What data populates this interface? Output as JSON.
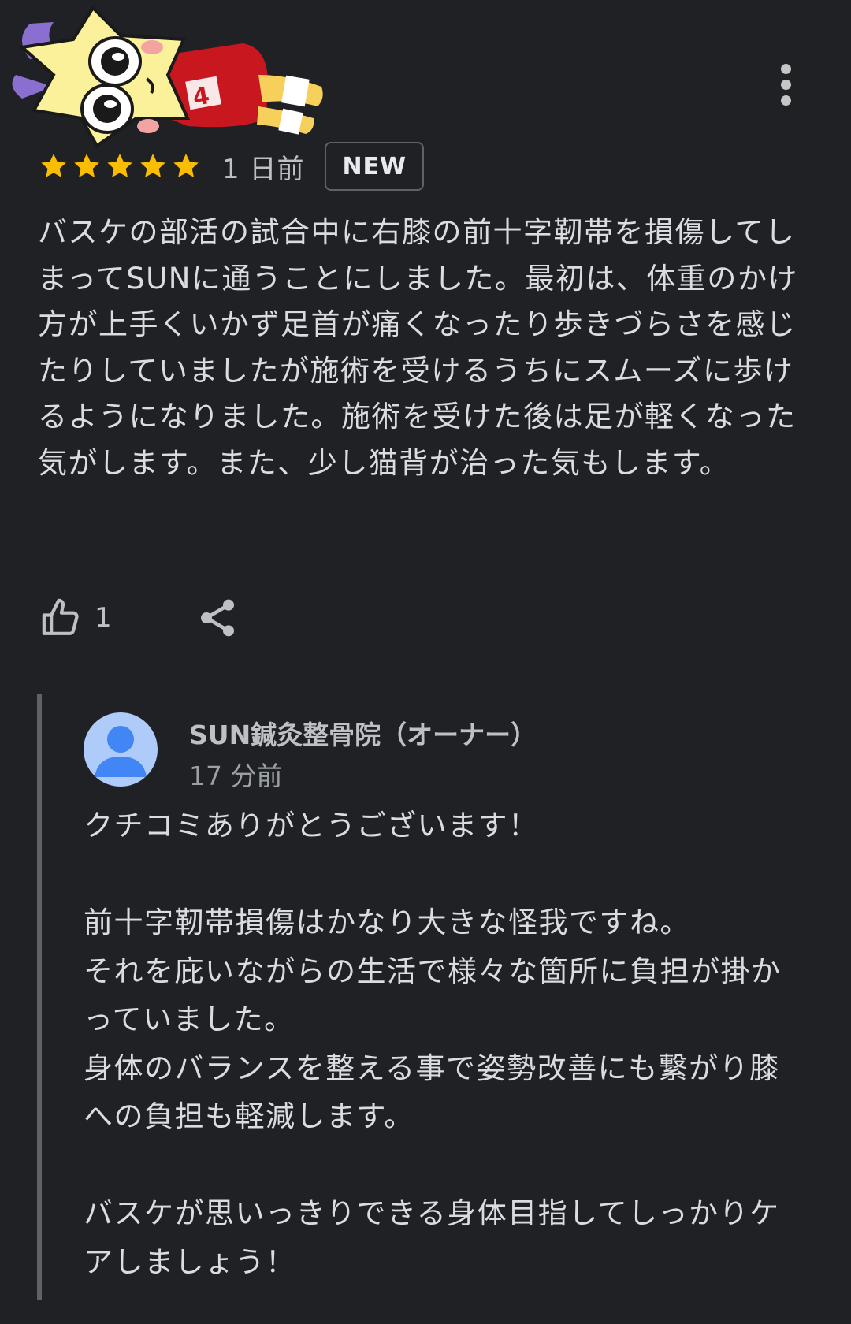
{
  "icons": {
    "sticker": "cartoon-star-character-sticker",
    "more": "more-vert-icon",
    "star": "star-icon",
    "like": "thumb-up-icon",
    "share": "share-icon",
    "avatar": "default-avatar-icon"
  },
  "colors": {
    "background": "#202124",
    "star": "#fbbc04",
    "text": "#dadce0",
    "muted": "#9aa0a6",
    "avatar": "#aecbfa",
    "avatar_figure": "#4285f4"
  },
  "review": {
    "rating": 5,
    "date": "1 日前",
    "badge": "NEW",
    "text": "バスケの部活の試合中に右膝の前十字靭帯を損傷してしまってSUNに通うことにしました。最初は、体重のかけ方が上手くいかず足首が痛くなったり歩きづらさを感じたりしていましたが施術を受けるうちにスムーズに歩けるようになりました。施術を受けた後は足が軽くなった気がします。また、少し猫背が治った気もします。",
    "likes": "1"
  },
  "reply": {
    "owner_name": "SUN鍼灸整骨院（オーナー）",
    "time": "17 分前",
    "text": "クチコミありがとうございます！\n\n前十字靭帯損傷はかなり大きな怪我ですね。\nそれを庇いながらの生活で様々な箇所に負担が掛かっていました。\n身体のバランスを整える事で姿勢改善にも繋がり膝への負担も軽減します。\n\nバスケが思いっきりできる身体目指してしっかりケアしましょう！"
  }
}
